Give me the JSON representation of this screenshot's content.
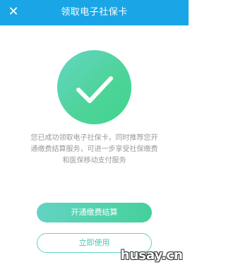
{
  "header": {
    "title": "领取电子社保卡",
    "close_icon": "close-icon",
    "background": "#1aa6e6"
  },
  "result": {
    "icon": "checkmark-icon",
    "description": "您已成功领取电子社保卡，同时推荐您开通缴费结算服务，可进一步享受社保缴费和医保移动支付服务"
  },
  "actions": {
    "primary_label": "开通缴费结算",
    "secondary_label": "立即使用"
  },
  "watermark": {
    "text": "husay.cn"
  },
  "colors": {
    "accent_start": "#63d3c4",
    "accent_end": "#45d19a",
    "text_muted": "#9a9a9a"
  }
}
